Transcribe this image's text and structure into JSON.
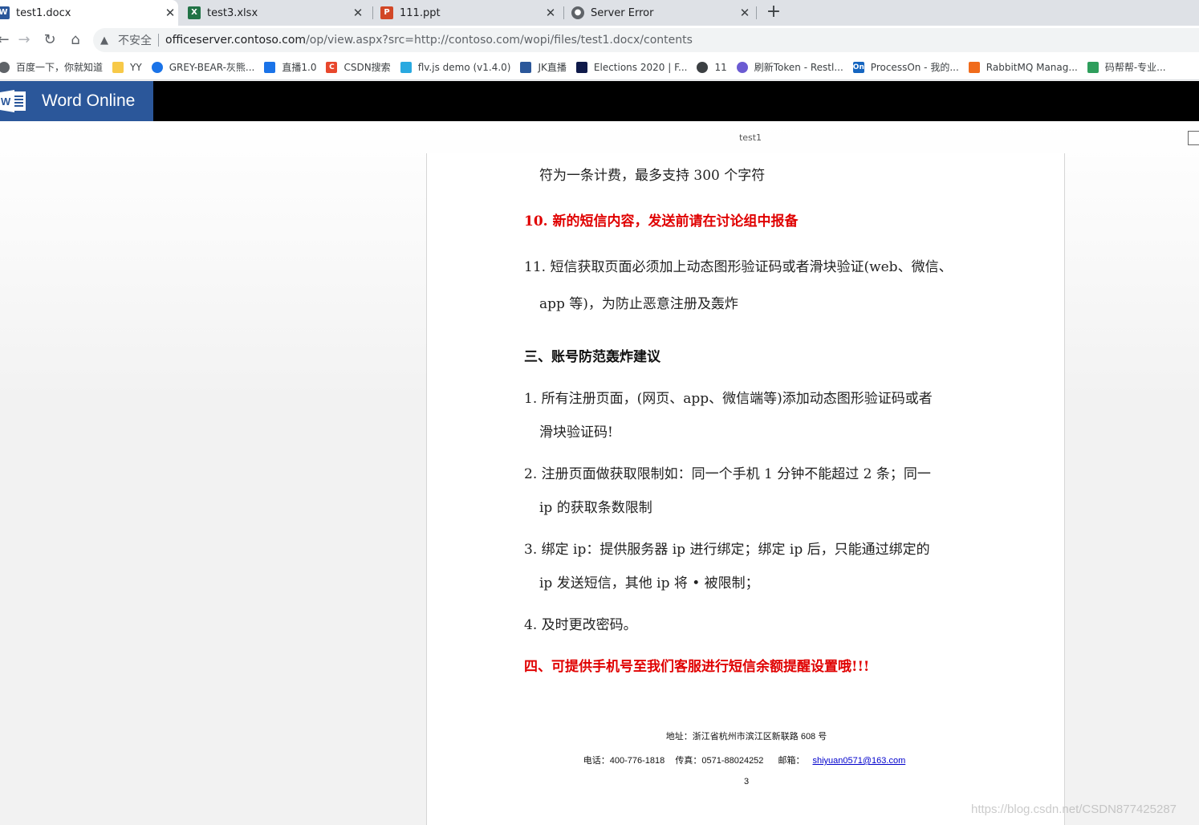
{
  "browser": {
    "tabs": [
      {
        "title": "test1.docx",
        "icon": "word-icon",
        "color": "#2b579a",
        "active": true
      },
      {
        "title": "test3.xlsx",
        "icon": "excel-icon",
        "color": "#217346",
        "active": false
      },
      {
        "title": "111.ppt",
        "icon": "powerpoint-icon",
        "color": "#d24726",
        "active": false
      },
      {
        "title": "Server Error",
        "icon": "globe-icon",
        "color": "#5f6368",
        "active": false
      }
    ],
    "new_tab_label": "+",
    "close_glyph": "✕",
    "address": {
      "warning": "不安全",
      "host": "officeserver.contoso.com",
      "path": "/op/view.aspx?src=http://contoso.com/wopi/files/test1.docx/contents"
    },
    "bookmarks": [
      {
        "label": "百度一下，你就知道",
        "color": "#5f6368"
      },
      {
        "label": "YY",
        "color": "#f7c948"
      },
      {
        "label": "GREY-BEAR-灰熊...",
        "color": "#1a73e8"
      },
      {
        "label": "直播1.0",
        "color": "#1a73e8"
      },
      {
        "label": "CSDN搜索",
        "color": "#e8472c"
      },
      {
        "label": "flv.js demo (v1.4.0)",
        "color": "#29a9e0"
      },
      {
        "label": "JK直播",
        "color": "#2b579a"
      },
      {
        "label": "Elections 2020 | F...",
        "color": "#0f1a4a"
      },
      {
        "label": "11",
        "color": "#3c4043"
      },
      {
        "label": "刷新Token - Restl...",
        "color": "#6b5bd2"
      },
      {
        "label": "ProcessOn - 我的...",
        "color": "#1565c0"
      },
      {
        "label": "RabbitMQ Manag...",
        "color": "#f06b1b"
      },
      {
        "label": "码帮帮-专业...",
        "color": "#2e9e5c"
      }
    ]
  },
  "word": {
    "brand": "Word Online",
    "doc_name": "test1"
  },
  "document": {
    "lines": [
      {
        "text": "符为一条计费，最多支持 300 个字符",
        "style": "normal"
      },
      {
        "text": "10. 新的短信内容，发送前请在讨论组中报备",
        "style": "red"
      },
      {
        "text": "11. 短信获取页面必须加上动态图形验证码或者滑块验证(web、微信、",
        "style": "normal"
      },
      {
        "text": "app 等)，为防止恶意注册及轰炸",
        "style": "normal"
      },
      {
        "text": "三、账号防范轰炸建议",
        "style": "bold"
      },
      {
        "text": "1. 所有注册页面，(网页、app、微信端等)添加动态图形验证码或者",
        "style": "normal"
      },
      {
        "text": "滑块验证码!",
        "style": "normal"
      },
      {
        "text": "2. 注册页面做获取限制如：同一个手机 1 分钟不能超过 2 条；同一",
        "style": "normal"
      },
      {
        "text": "ip 的获取条数限制",
        "style": "normal"
      },
      {
        "text": "3. 绑定 ip：提供服务器 ip 进行绑定；绑定 ip 后，只能通过绑定的",
        "style": "normal"
      },
      {
        "text": "ip 发送短信，其他 ip 将 • 被限制；",
        "style": "normal"
      },
      {
        "text": "4. 及时更改密码。",
        "style": "normal"
      },
      {
        "text": "四、可提供手机号至我们客服进行短信余额提醒设置哦!!!",
        "style": "red"
      }
    ],
    "footer": {
      "address": "地址：浙江省杭州市滨江区新联路 608 号",
      "phone": "电话：400-776-1818",
      "fax": "传真：0571-88024252",
      "email_label": "邮箱：",
      "email": "shiyuan0571@163.com",
      "page_number": "3"
    }
  },
  "watermark": "https://blog.csdn.net/CSDN877425287"
}
